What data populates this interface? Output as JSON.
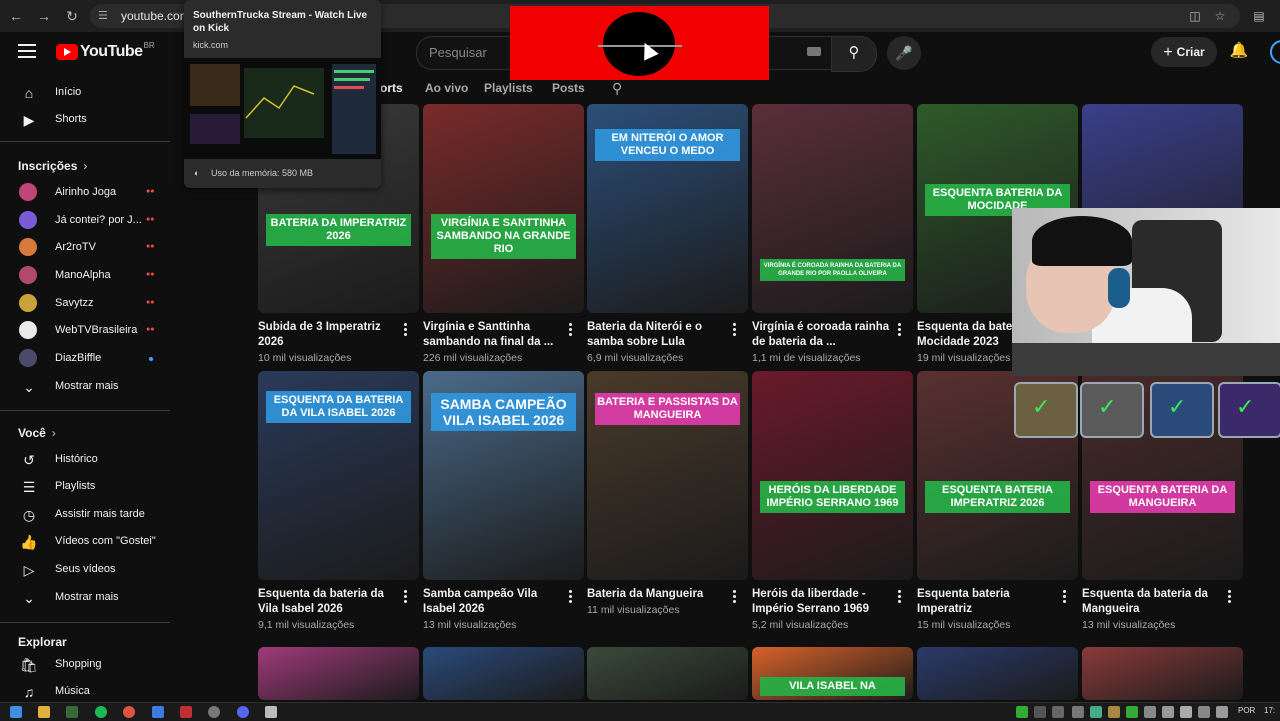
{
  "browser": {
    "url": "youtube.com",
    "icons": [
      "back-icon",
      "forward-icon",
      "reload-icon",
      "site-settings-icon",
      "cast-icon",
      "bookmark-star-icon",
      "side-panel-icon"
    ]
  },
  "tab_popup": {
    "title": "SouthernTrucka Stream - Watch Live on Kick",
    "domain": "kick.com",
    "memory": "Uso da memória: 580 MB"
  },
  "header": {
    "logo_text": "YouTube",
    "country_code": "BR",
    "search_placeholder": "Pesquisar",
    "create_label": "Criar"
  },
  "sidebar": {
    "main": [
      {
        "label": "Início",
        "icon": "home-icon"
      },
      {
        "label": "Shorts",
        "icon": "shorts-icon"
      }
    ],
    "subscriptions_header": "Inscrições",
    "subscriptions": [
      {
        "label": "Airinho Joga",
        "status": "live",
        "color": "#c0457a"
      },
      {
        "label": "Já contei? por J...",
        "status": "live",
        "color": "#7a5bd6"
      },
      {
        "label": "Ar2roTV",
        "status": "live",
        "color": "#d67a3b"
      },
      {
        "label": "ManoAlpha",
        "status": "live",
        "color": "#b04a6b"
      },
      {
        "label": "Savytzz",
        "status": "live",
        "color": "#caa23a"
      },
      {
        "label": "WebTVBrasileira",
        "status": "live",
        "color": "#e9e9e9"
      },
      {
        "label": "DiazBiffle",
        "status": "new",
        "color": "#4a4a6a"
      }
    ],
    "subscriptions_more": "Mostrar mais",
    "you_header": "Você",
    "you_items": [
      {
        "label": "Histórico",
        "icon": "history-icon"
      },
      {
        "label": "Playlists",
        "icon": "playlists-icon"
      },
      {
        "label": "Assistir mais tarde",
        "icon": "watch-later-icon"
      },
      {
        "label": "Vídeos com \"Gostei\"",
        "icon": "like-icon"
      },
      {
        "label": "Seus vídeos",
        "icon": "your-videos-icon"
      }
    ],
    "you_more": "Mostrar mais",
    "explore_header": "Explorar",
    "explore_items": [
      {
        "label": "Shopping",
        "icon": "shopping-icon"
      },
      {
        "label": "Música",
        "icon": "music-icon"
      }
    ]
  },
  "channel_tabs": [
    "orts",
    "Ao vivo",
    "Playlists",
    "Posts"
  ],
  "videos": [
    {
      "title": "Subida de 3 Imperatriz 2026",
      "views": "10 mil visualizações",
      "caption": "BATERIA DA IMPERATRIZ 2026",
      "caption_color": "green",
      "bg": "#3a3a3a"
    },
    {
      "title": "Virgínia e Santtinha sambando na final da ...",
      "views": "226 mil visualizações",
      "caption": "VIRGÍNIA E SANTTINHA SAMBANDO NA GRANDE RIO",
      "caption_color": "green",
      "bg": "#7a2a2a"
    },
    {
      "title": "Bateria da Niterói e o samba sobre Lula",
      "views": "6,9 mil visualizações",
      "caption": "EM NITERÓI O AMOR VENCEU O MEDO",
      "caption_color": "blue",
      "bg": "#2c4f7a"
    },
    {
      "title": "Virgínia é coroada rainha de bateria da ...",
      "views": "1,1 mi de visualizações",
      "caption": "VIRGÍNIA É COROADA RAINHA DA BATERIA DA GRANDE RIO POR PAOLLA OLIVEIRA",
      "caption_color": "green",
      "bg": "#5a2e3a"
    },
    {
      "title": "Esquenta da bate... Mocidade 2023",
      "views": "19 mil visualizações",
      "caption": "ESQUENTA BATERIA DA MOCIDADE",
      "caption_color": "green",
      "bg": "#2f5a2a"
    },
    {
      "title": "",
      "views": "",
      "caption": "",
      "caption_color": "none",
      "bg": "#3a3f8a"
    },
    {
      "title": "Esquenta da bateria da Vila Isabel 2026",
      "views": "9,1 mil visualizações",
      "caption": "ESQUENTA DA BATERIA DA VILA ISABEL 2026",
      "caption_color": "blue",
      "bg": "#2a3a5a"
    },
    {
      "title": "Samba campeão Vila Isabel 2026",
      "views": "13 mil visualizações",
      "caption": "SAMBA CAMPEÃO VILA ISABEL 2026",
      "caption_color": "blue",
      "bg": "#4a6a8a"
    },
    {
      "title": "Bateria da Mangueira",
      "views": "11 mil visualizações",
      "caption": "BATERIA E PASSISTAS DA MANGUEIRA",
      "caption_color": "pink",
      "bg": "#4a3a2a"
    },
    {
      "title": "Heróis da liberdade - Império Serrano 1969",
      "views": "5,2 mil visualizações",
      "caption": "HERÓIS DA LIBERDADE IMPÉRIO SERRANO 1969",
      "caption_color": "green",
      "bg": "#6a1a2a"
    },
    {
      "title": "Esquenta bateria Imperatriz",
      "views": "15 mil visualizações",
      "caption": "ESQUENTA BATERIA IMPERATRIZ 2026",
      "caption_color": "green",
      "bg": "#5a3030"
    },
    {
      "title": "Esquenta da bateria da Mangueira",
      "views": "13 mil visualizações",
      "caption": "ESQUENTA BATERIA DA MANGUEIRA",
      "caption_color": "pink",
      "bg": "#4a2a2a"
    },
    {
      "title": "",
      "views": "",
      "caption": "",
      "caption_color": "none",
      "bg": "#a03a7a"
    },
    {
      "title": "",
      "views": "",
      "caption": "",
      "caption_color": "none",
      "bg": "#2a4a7a"
    },
    {
      "title": "",
      "views": "",
      "caption": "",
      "caption_color": "none",
      "bg": "#3a4a3a"
    },
    {
      "title": "",
      "views": "",
      "caption": "VILA ISABEL NA",
      "caption_color": "green",
      "bg": "#d8622a"
    },
    {
      "title": "",
      "views": "",
      "caption": "",
      "caption_color": "none",
      "bg": "#2a3a6a"
    },
    {
      "title": "",
      "views": "",
      "caption": "",
      "caption_color": "none",
      "bg": "#8a3a3a"
    }
  ],
  "taskbar": {
    "language": "POR",
    "clock": "17:"
  }
}
